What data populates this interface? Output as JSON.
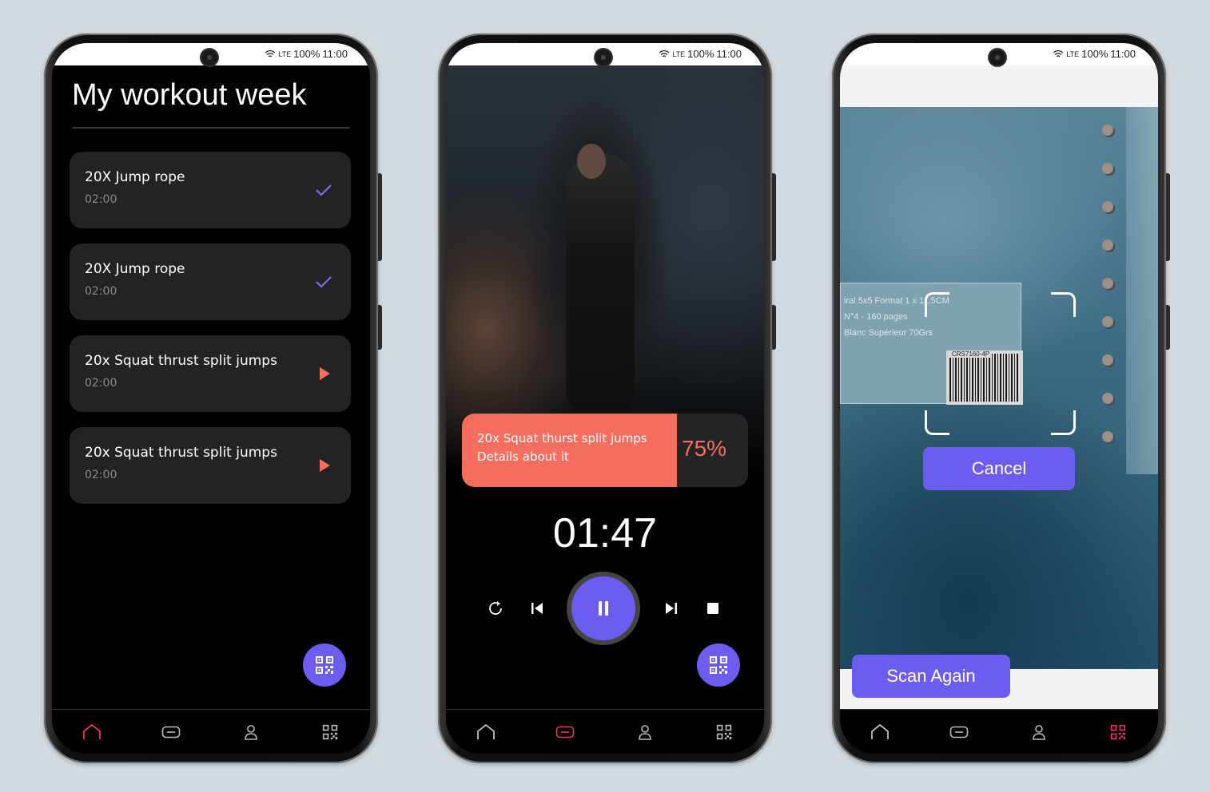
{
  "status_bar": {
    "network": "LTE",
    "battery": "100%",
    "time": "11:00"
  },
  "colors": {
    "accent": "#6c5cf0",
    "coral": "#f36e5e",
    "nav_active": "#e8335e",
    "card_bg": "#232323"
  },
  "workout_screen": {
    "title": "My workout week",
    "items": [
      {
        "name": "20X Jump rope",
        "time": "02:00",
        "status_icon": "check-icon"
      },
      {
        "name": "20X Jump rope",
        "time": "02:00",
        "status_icon": "check-icon"
      },
      {
        "name": "20x Squat thrust split jumps",
        "time": "02:00",
        "status_icon": "play-icon"
      },
      {
        "name": "20x Squat thrust split jumps",
        "time": "02:00",
        "status_icon": "play-icon"
      }
    ],
    "fab_icon": "qr-code-icon",
    "nav_active": "home"
  },
  "player_screen": {
    "exercise": "20x Squat thurst split jumps",
    "details": "Details about it",
    "progress_percent": 75,
    "progress_label": "75%",
    "timer": "01:47",
    "controls": [
      "restart-icon",
      "previous-icon",
      "pause-icon",
      "next-icon",
      "stop-icon"
    ],
    "fab_icon": "qr-code-icon",
    "nav_active": "player"
  },
  "scan_screen": {
    "label_lines": [
      "iral 5x5 Format 1 x 11.5CM",
      "N°4 - 160 pages",
      "Blanc Supérieur 70Grs",
      "CRS7160-4P"
    ],
    "cancel_label": "Cancel",
    "scan_again_label": "Scan Again",
    "nav_active": "scan"
  },
  "nav": [
    "home-icon",
    "player-icon",
    "profile-icon",
    "qr-code-icon"
  ]
}
